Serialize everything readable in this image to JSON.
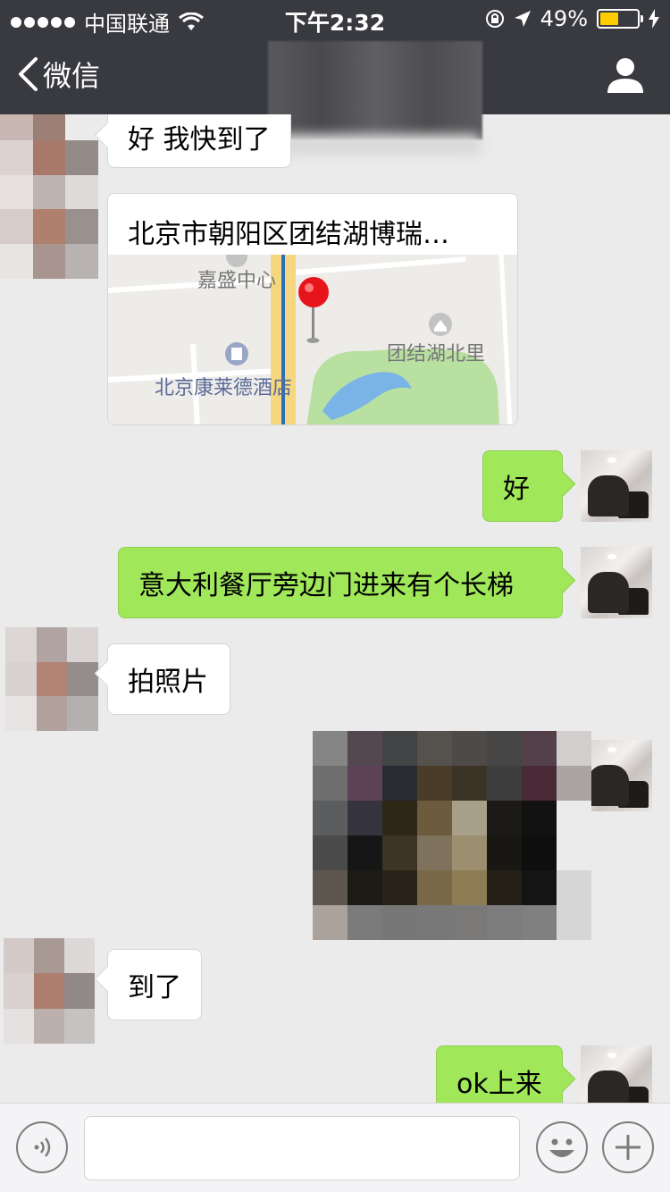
{
  "status_bar": {
    "carrier": "中国联通",
    "time": "下午2:32",
    "battery_percent": "49%",
    "battery_level": 0.49
  },
  "nav": {
    "back_label": "微信"
  },
  "messages": [
    {
      "side": "left",
      "type": "text",
      "text": "好 我快到了"
    },
    {
      "side": "left",
      "type": "location",
      "text": "北京市朝阳区团结湖博瑞…",
      "map_labels": {
        "poi_1": "嘉盛中心",
        "poi_2": "团结湖北里",
        "poi_3": "北京康莱德酒店"
      }
    },
    {
      "side": "right",
      "type": "text",
      "text": "好"
    },
    {
      "side": "right",
      "type": "text",
      "text": "意大利餐厅旁边门进来有个长梯"
    },
    {
      "side": "left",
      "type": "text",
      "text": "拍照片"
    },
    {
      "side": "right",
      "type": "image"
    },
    {
      "side": "left",
      "type": "text",
      "text": "到了"
    },
    {
      "side": "right",
      "type": "text",
      "text": "ok上来"
    }
  ],
  "input": {
    "value": "",
    "placeholder": ""
  },
  "colors": {
    "header_bg": "#393a3f",
    "chat_bg": "#ebebeb",
    "sent_bubble": "#a0e75a",
    "received_bubble": "#ffffff",
    "battery_fill": "#ffcc00"
  },
  "icons": {
    "back": "chevron-left-icon",
    "profile": "person-icon",
    "voice": "voice-icon",
    "emoji": "smiley-icon",
    "plus": "plus-icon",
    "map_pin": "map-pin-icon"
  }
}
